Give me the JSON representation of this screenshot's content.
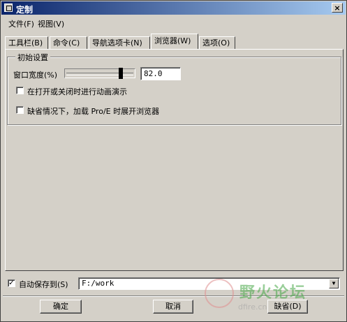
{
  "window": {
    "title": "定制",
    "close_glyph": "×"
  },
  "menu": [
    {
      "label": "文件(F)"
    },
    {
      "label": "视图(V)"
    }
  ],
  "tabs": [
    {
      "label": "工具栏(B)"
    },
    {
      "label": "命令(C)"
    },
    {
      "label": "导航选项卡(N)"
    },
    {
      "label": "浏览器(W)",
      "active": true
    },
    {
      "label": "选项(O)"
    }
  ],
  "browser_tab": {
    "group_title": "初始设置",
    "window_width_label": "窗口宽度(%)",
    "window_width_value": "82.0",
    "window_width_fraction": 0.82,
    "animate_label": "在打开或关闭时进行动画演示",
    "animate_checked": false,
    "expand_label": "缺省情况下，加载 Pro/E 时展开浏览器",
    "expand_checked": false
  },
  "autosave": {
    "label": "自动保存到(S)",
    "checked": true,
    "path": "F:/work"
  },
  "buttons": {
    "ok": "确定",
    "cancel": "取消",
    "default": "缺省(D)"
  },
  "watermark": {
    "text": "野火论坛",
    "url": "dfire.cn"
  },
  "icons": {
    "app": "app-window-icon",
    "close": "close-icon",
    "dropdown": "chevron-down-icon",
    "check": "checkmark-icon"
  }
}
